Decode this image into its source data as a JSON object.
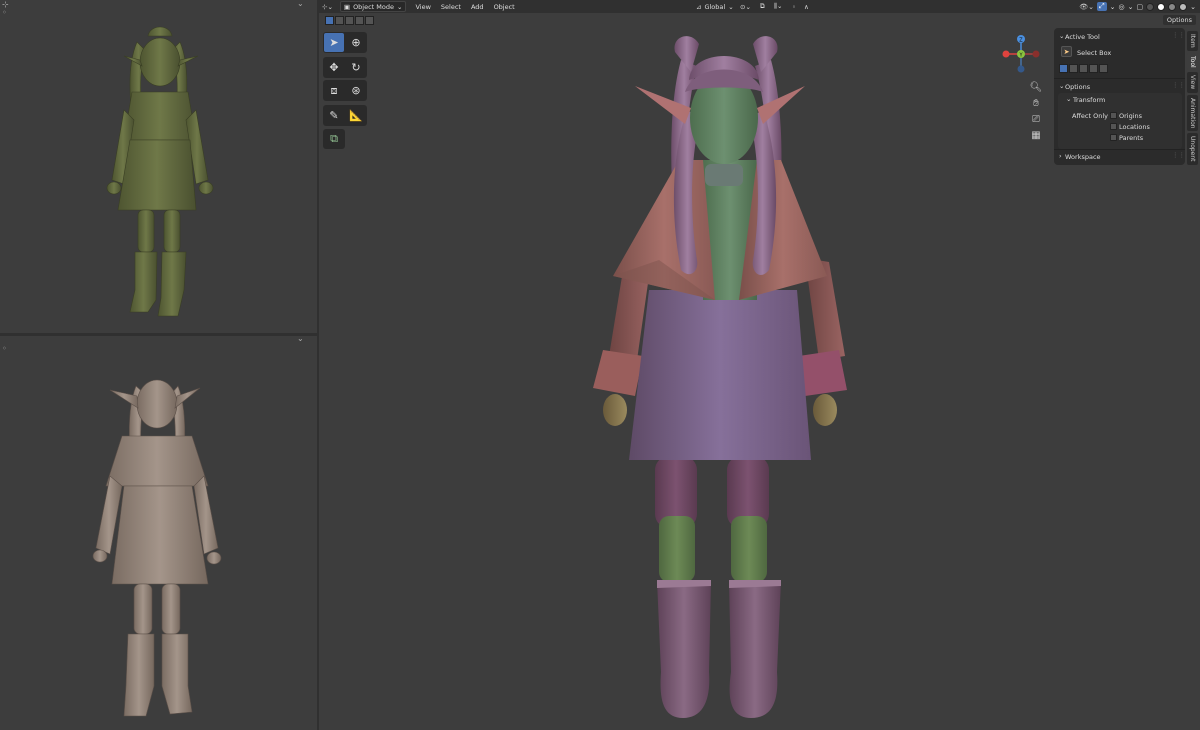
{
  "header": {
    "mode_label": "Object Mode",
    "menus": [
      "View",
      "Select",
      "Add",
      "Object"
    ],
    "transform_orientation": "Global",
    "options_label": "Options"
  },
  "gizmo": {
    "z": "Z",
    "y": "Y"
  },
  "sidebar": {
    "active_tool_title": "Active Tool",
    "tool_name": "Select Box",
    "options_title": "Options",
    "transform_title": "Transform",
    "affect_only_label": "Affect Only",
    "affect_items": [
      "Origins",
      "Locations",
      "Parents"
    ],
    "workspace_title": "Workspace",
    "tabs": [
      "Item",
      "Tool",
      "View",
      "Animation",
      "Unopent"
    ]
  },
  "icons": {
    "select_box": "select-box-icon",
    "cursor": "cursor-icon",
    "move": "move-icon",
    "rotate": "rotate-icon",
    "scale": "scale-icon",
    "transform": "transform-icon",
    "annotate": "annotate-icon",
    "measure": "measure-icon",
    "add_cube": "add-cube-icon"
  },
  "colors": {
    "viewport_bg": "#3d3d3d",
    "header_bg": "#303030",
    "accent": "#4772b3",
    "axis_x": "#e0433e",
    "axis_y": "#8bc53f",
    "axis_z": "#4a8fdf"
  }
}
